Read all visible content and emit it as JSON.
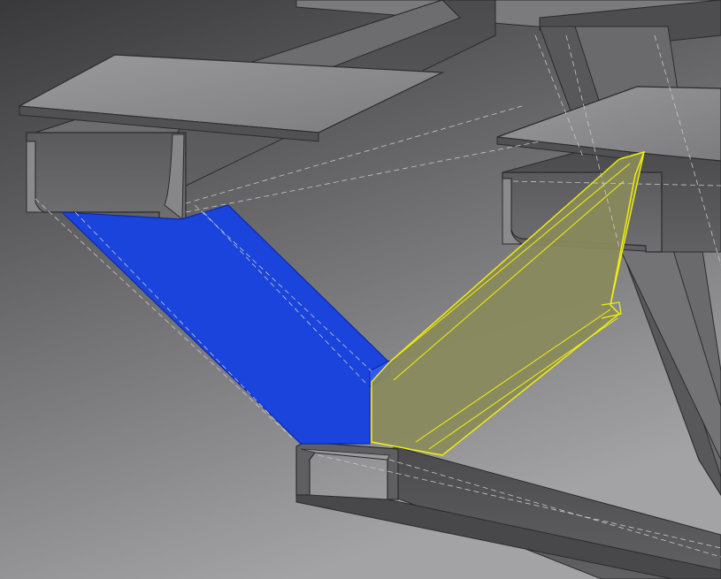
{
  "scene": {
    "description_visible_text": "",
    "colors": {
      "background_top": "#3b3b3d",
      "background_bottom": "#9c9c9e",
      "steel_light": "#8d8d90",
      "steel_mid": "#6b6b6e",
      "steel_dark": "#4a4a4d",
      "steel_edge": "#2b2b2d",
      "selected_member_blue": "#1a44dc",
      "highlighted_member_yellow": "#8a8a5c",
      "highlight_outline_yellow": "#f2f20a",
      "hidden_edge": "#c8c8cc"
    },
    "members": [
      {
        "id": "top-plate-left",
        "kind": "plate"
      },
      {
        "id": "top-plate-right",
        "kind": "plate"
      },
      {
        "id": "top-plate-far",
        "kind": "plate"
      },
      {
        "id": "channel-left-beam",
        "kind": "channel"
      },
      {
        "id": "channel-right-beam",
        "kind": "channel"
      },
      {
        "id": "channel-bottom-beam",
        "kind": "channel"
      },
      {
        "id": "diagonal-brace-left",
        "kind": "angle",
        "state": "selected"
      },
      {
        "id": "diagonal-brace-right",
        "kind": "angle",
        "state": "highlighted"
      },
      {
        "id": "vertical-brace-right",
        "kind": "channel"
      }
    ]
  }
}
